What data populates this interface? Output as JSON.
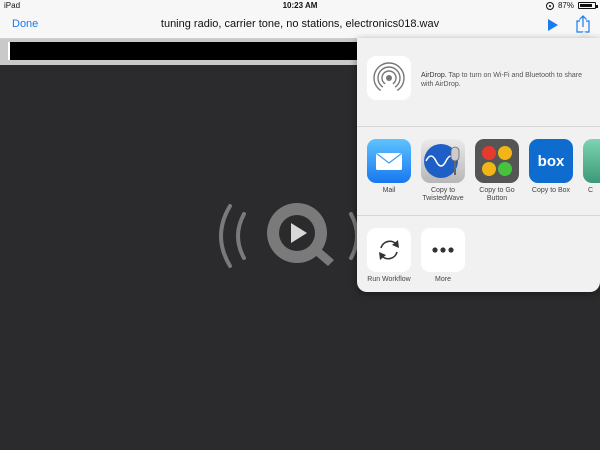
{
  "status_bar": {
    "device": "iPad",
    "time": "10:23 AM",
    "battery": "87%",
    "battery_level": 0.87
  },
  "nav": {
    "done_label": "Done",
    "title": "tuning radio, carrier tone, no stations, electronics018.wav",
    "accent_color": "#1a7bf0"
  },
  "share_sheet": {
    "airdrop": {
      "title": "AirDrop.",
      "description": " Tap to turn on Wi-Fi and Bluetooth to share with AirDrop."
    },
    "apps": [
      {
        "label": "Mail",
        "icon": "mail-icon"
      },
      {
        "label": "Copy to TwistedWave",
        "icon": "twistedwave-icon"
      },
      {
        "label": "Copy to Go Button",
        "icon": "go-button-icon"
      },
      {
        "label": "Copy to Box",
        "icon": "box-icon"
      },
      {
        "label": "C",
        "icon": "app-icon"
      }
    ],
    "actions": [
      {
        "label": "Run Workflow",
        "icon": "workflow-icon"
      },
      {
        "label": "More",
        "icon": "more-icon"
      }
    ]
  },
  "player": {
    "icon": "quicktime-play-icon"
  }
}
